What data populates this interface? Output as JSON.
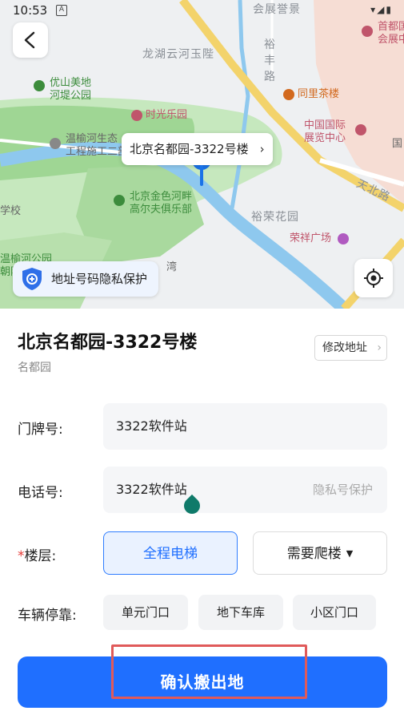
{
  "status_bar": {
    "time": "10:53",
    "notif_icon": "A"
  },
  "map": {
    "labels": {
      "expo_garden": "会展誉景",
      "capital_expo": "首都国\n会展中",
      "longhu": "龙湖云河玉陛",
      "yufeng_road": "裕\n丰\n路",
      "youshan_park": "优山美地\n河堤公园",
      "tongli_tea": "同里茶楼",
      "shiguang_park": "时光乐园",
      "china_expo": "中国国际\n展览中心",
      "wenyu_eco": "温榆河生态\n工程施工二部",
      "tianbei_road": "天北路",
      "school": "学校",
      "golf_club": "北京金色河畔\n高尔夫俱乐部",
      "yurong_garden": "裕荣花园",
      "rongxiang_plaza": "荣祥广场",
      "wenyu_park_partial": "温榆河公园\n朝阳",
      "wan": "湾",
      "guo_partial": "国"
    },
    "address_bubble": "北京名都园-3322号楼",
    "privacy_label": "地址号码隐私保护"
  },
  "sheet": {
    "title": "北京名都园-3322号楼",
    "subtitle": "名都园",
    "edit_button": "修改地址",
    "door_label": "门牌号:",
    "door_value": "3322软件站",
    "phone_label": "电话号:",
    "phone_value": "3322软件站",
    "phone_hint": "隐私号保护",
    "floor_required_mark": "*",
    "floor_label": "楼层:",
    "floor_option_elevator": "全程电梯",
    "floor_option_stairs": "需要爬楼",
    "parking_label": "车辆停靠:",
    "parking_options": [
      "单元门口",
      "地下车库",
      "小区门口"
    ],
    "confirm_button": "确认搬出地"
  },
  "colors": {
    "accent": "#1f6fff",
    "selected_bg": "#eaf2ff",
    "highlight": "#e05a5a",
    "required": "#e53935"
  }
}
